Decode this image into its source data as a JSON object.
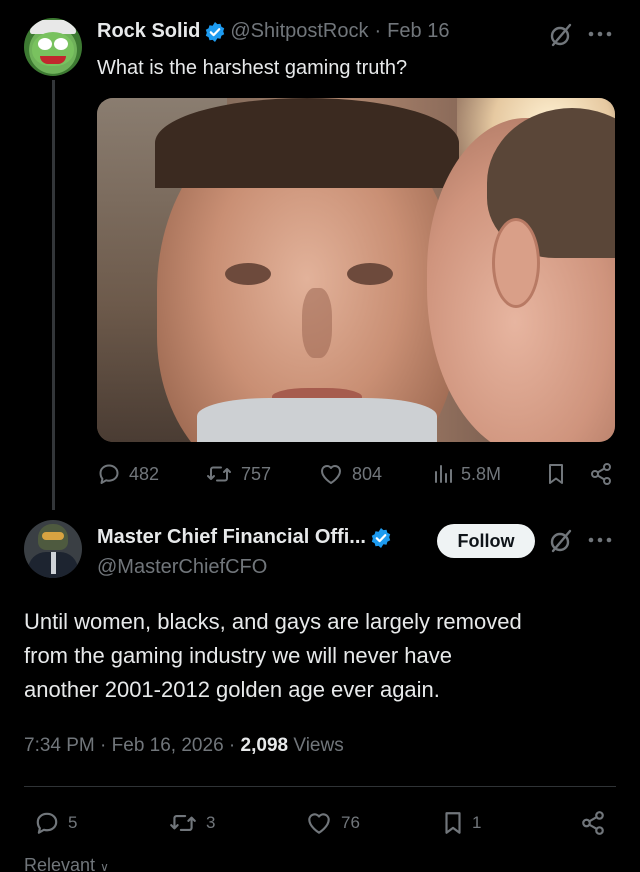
{
  "original_tweet": {
    "display_name": "Rock Solid",
    "handle": "@ShitpostRock",
    "separator": "·",
    "date": "Feb 16",
    "text": "What is the harshest gaming truth?",
    "avatar_icon": "frog-avatar",
    "stats": {
      "replies": "482",
      "reposts": "757",
      "likes": "804",
      "views": "5.8M"
    }
  },
  "reply_tweet": {
    "display_name": "Master Chief Financial Offi...",
    "handle": "@MasterChiefCFO",
    "follow_label": "Follow",
    "avatar_icon": "master-chief-suit-avatar",
    "text_lines": [
      "Until women, blacks, and gays are largely removed",
      "from the gaming industry we will never have",
      "another 2001-2012 golden age ever again."
    ],
    "time": "7:34 PM",
    "sep1": "·",
    "date": "Feb 16, 2026",
    "sep2": "·",
    "views_count": "2,098",
    "views_label": "Views",
    "stats": {
      "replies": "5",
      "reposts": "3",
      "likes": "76",
      "bookmarks": "1"
    }
  },
  "sort_label": "Relevant",
  "colors": {
    "background": "#000000",
    "text_primary": "#e7e9ea",
    "text_secondary": "#71767b",
    "verified_blue": "#1d9bf0",
    "follow_button_bg": "#eff3f4"
  }
}
